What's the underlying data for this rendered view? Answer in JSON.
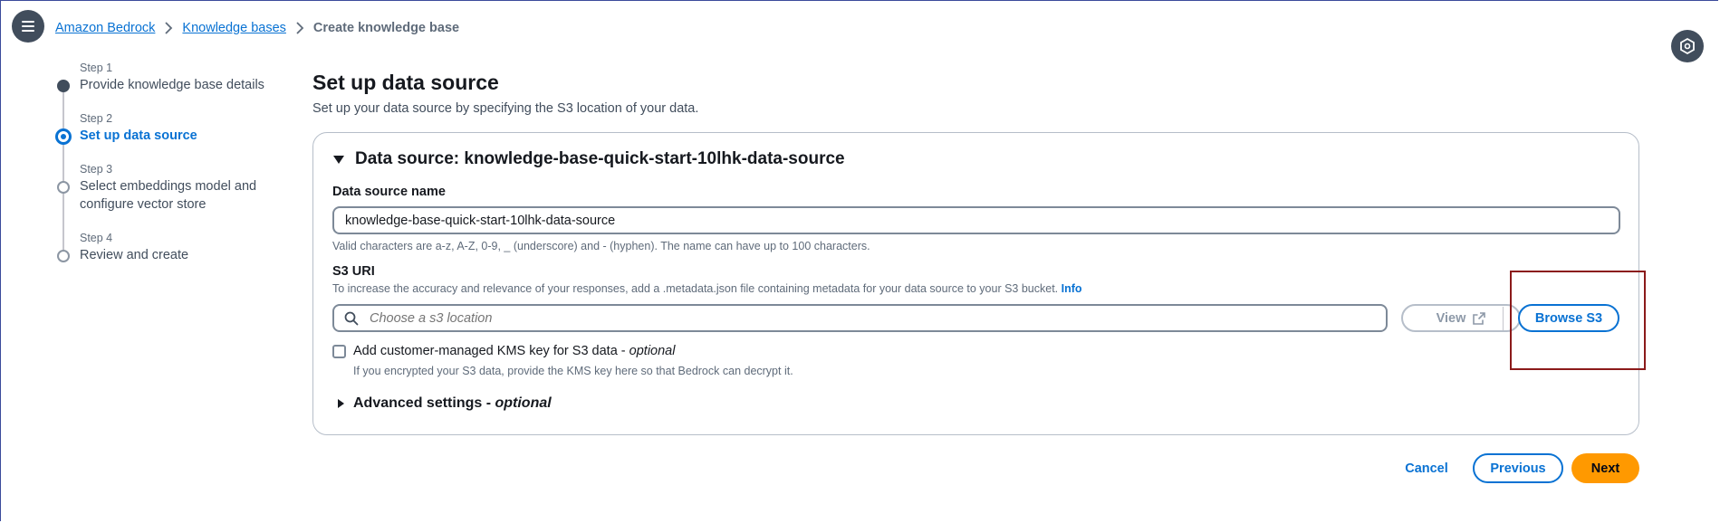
{
  "breadcrumb": {
    "items": [
      "Amazon Bedrock",
      "Knowledge bases"
    ],
    "current": "Create knowledge base"
  },
  "steps": [
    {
      "num": "Step 1",
      "label": "Provide knowledge base details",
      "state": "done"
    },
    {
      "num": "Step 2",
      "label": "Set up data source",
      "state": "active"
    },
    {
      "num": "Step 3",
      "label": "Select embeddings model and configure vector store",
      "state": "todo"
    },
    {
      "num": "Step 4",
      "label": "Review and create",
      "state": "todo"
    }
  ],
  "page": {
    "title": "Set up data source",
    "description": "Set up your data source by specifying the S3 location of your data."
  },
  "data_source": {
    "header": "Data source: knowledge-base-quick-start-10lhk-data-source",
    "name_label": "Data source name",
    "name_value": "knowledge-base-quick-start-10lhk-data-source",
    "name_hint": "Valid characters are a-z, A-Z, 0-9, _ (underscore) and - (hyphen). The name can have up to 100 characters.",
    "s3_label": "S3 URI",
    "s3_hint": "To increase the accuracy and relevance of your responses, add a .metadata.json file containing metadata for your data source to your S3 bucket.",
    "info_link": "Info",
    "s3_placeholder": "Choose a s3 location",
    "view_button": "View",
    "browse_button": "Browse S3",
    "kms_label": "Add customer-managed KMS key for S3 data -",
    "kms_optional": "optional",
    "kms_hint": "If you encrypted your S3 data, provide the KMS key here so that Bedrock can decrypt it.",
    "advanced_label": "Advanced settings -",
    "advanced_optional": "optional"
  },
  "footer": {
    "cancel": "Cancel",
    "previous": "Previous",
    "next": "Next"
  },
  "colors": {
    "accent": "#0972d3",
    "primary_button": "#ff9900",
    "highlight": "#8b1a1a"
  }
}
